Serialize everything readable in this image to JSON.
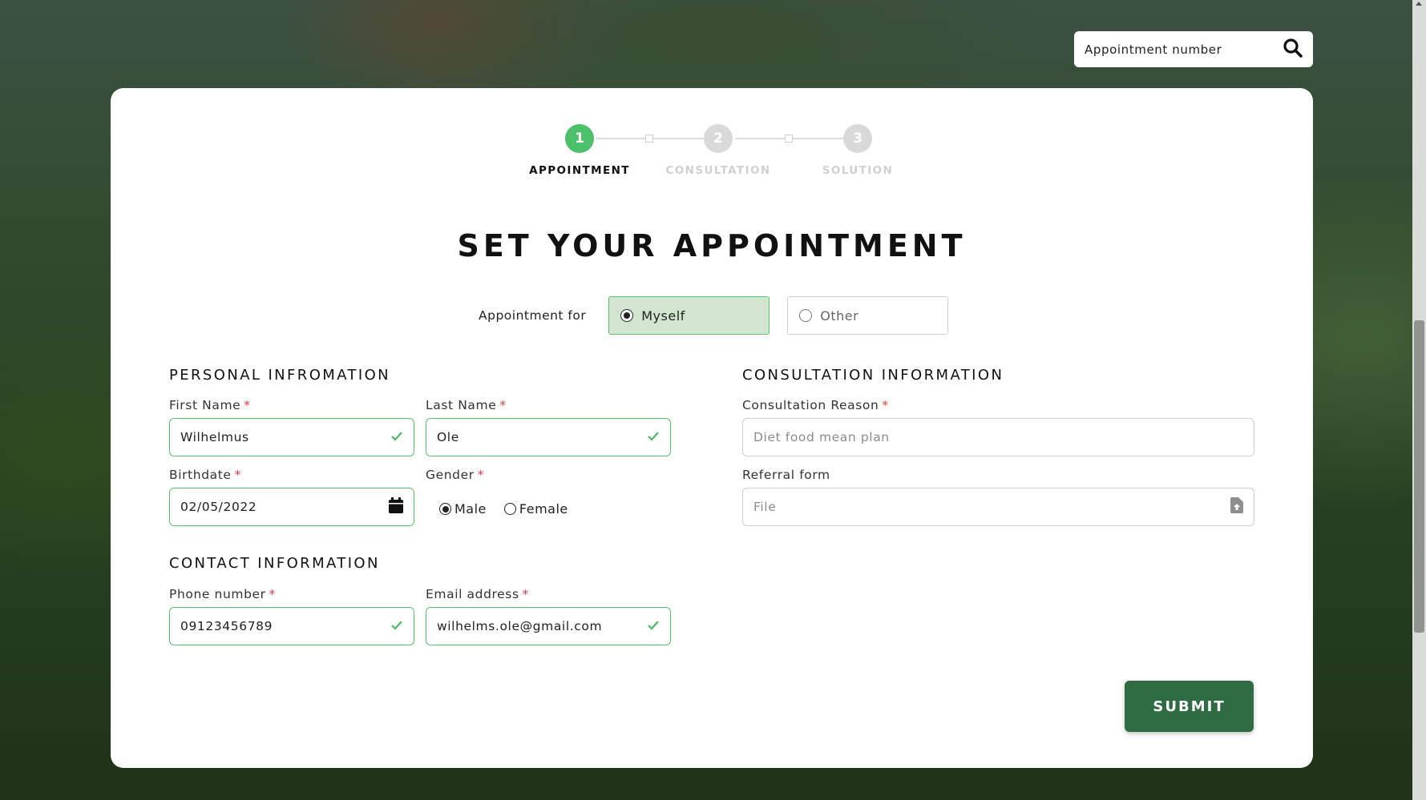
{
  "search": {
    "placeholder": "Appointment number",
    "icon": "search-icon"
  },
  "stepper": {
    "steps": [
      {
        "number": "1",
        "label": "APPOINTMENT",
        "state": "active"
      },
      {
        "number": "2",
        "label": "CONSULTATION",
        "state": "inactive"
      },
      {
        "number": "3",
        "label": "SOLUTION",
        "state": "inactive"
      }
    ]
  },
  "form": {
    "title": "SET YOUR APPOINTMENT",
    "appointment_for": {
      "label": "Appointment for",
      "options": [
        "Myself",
        "Other"
      ],
      "selected": "Myself"
    },
    "personal": {
      "heading": "PERSONAL INFROMATION",
      "first_name": {
        "label": "First Name",
        "value": "Wilhelmus"
      },
      "last_name": {
        "label": "Last Name",
        "value": "Ole"
      },
      "birthdate": {
        "label": "Birthdate",
        "value": "02/05/2022"
      },
      "gender": {
        "label": "Gender",
        "options": [
          "Male",
          "Female"
        ],
        "selected": "Male"
      }
    },
    "contact": {
      "heading": "CONTACT INFORMATION",
      "phone": {
        "label": "Phone number",
        "value": "09123456789"
      },
      "email": {
        "label": "Email address",
        "value": "wilhelms.ole@gmail.com"
      }
    },
    "consultation": {
      "heading": "CONSULTATION INFORMATION",
      "reason": {
        "label": "Consultation Reason",
        "placeholder": "Diet food mean plan"
      },
      "referral": {
        "label": "Referral form",
        "placeholder": "File"
      }
    },
    "required_mark": "*",
    "submit_label": "SUBMIT"
  },
  "colors": {
    "accent_green": "#55c16a",
    "step_active": "#4cc06a",
    "step_inactive": "#d9d9d9",
    "submit_bg": "#2f6b43",
    "required": "#e23c3c"
  }
}
